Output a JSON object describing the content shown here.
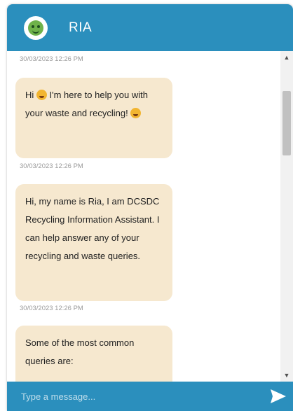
{
  "header": {
    "title": "RIA",
    "avatar_icon": "bot-face-icon",
    "color": "#2b8fbd"
  },
  "messages": [
    {
      "timestamp": "30/03/2023 12:26 PM",
      "text_before_emoji": "Hi ",
      "text_after_emoji": " I'm here to help you with your waste and recycling! ",
      "emoji_icons": [
        "smiley-emoji-icon",
        "grin-emoji-icon"
      ]
    },
    {
      "timestamp": "30/03/2023 12:26 PM",
      "text": "Hi, my name is Ria, I am DCSDC Recycling Information Assistant. I can help answer any of your recycling and waste queries."
    },
    {
      "timestamp": "30/03/2023 12:26 PM",
      "text": "Some of the most common queries are:"
    }
  ],
  "input": {
    "placeholder": "Type a message..."
  },
  "colors": {
    "bubble": "#f6e8cf",
    "accent": "#2b8fbd"
  }
}
